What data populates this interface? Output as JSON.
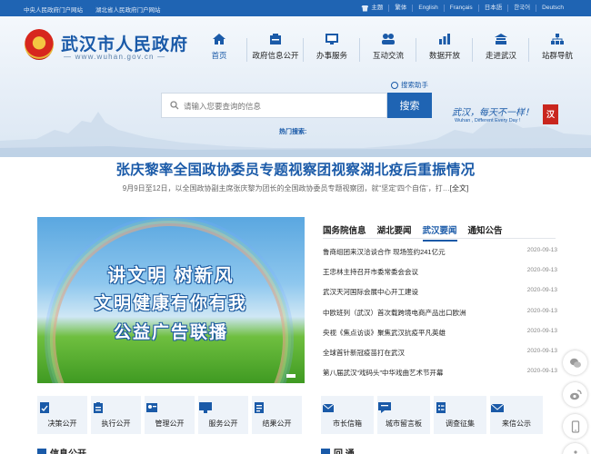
{
  "topbar": {
    "left_links": [
      "中央人民政府门户网站",
      "湖北省人民政府门户网站"
    ],
    "theme_label": "主题",
    "languages": [
      "繁体",
      "English",
      "Français",
      "日本語",
      "한국어",
      "Deutsch"
    ]
  },
  "header": {
    "site_name": "武汉市人民政府",
    "site_url": "— www.wuhan.gov.cn —",
    "nav": [
      {
        "label": "首页",
        "icon": "home-icon"
      },
      {
        "label": "政府信息公开",
        "icon": "info-disclosure-icon"
      },
      {
        "label": "办事服务",
        "icon": "service-icon"
      },
      {
        "label": "互动交流",
        "icon": "interaction-icon"
      },
      {
        "label": "数据开放",
        "icon": "data-icon"
      },
      {
        "label": "走进武汉",
        "icon": "city-icon"
      },
      {
        "label": "站群导航",
        "icon": "sitemap-icon"
      }
    ],
    "search_helper": "搜索助手",
    "search_placeholder": "请输入您要查询的信息",
    "search_button": "搜索",
    "hot_search": "热门搜索:",
    "slogan": "武汉，每天不一样！",
    "slogan_en": "Wuhan , Different Every Day !"
  },
  "headline": {
    "title": "张庆黎率全国政协委员专题视察团视察湖北疫后重振情况",
    "summary": "9月9日至12日，以全国政协副主席张庆黎为团长的全国政协委员专题视察团，就“坚定‘四个自信’，打…",
    "full_text": "[全文]"
  },
  "banner": {
    "line1": "讲文明 树新风",
    "line2": "文明健康有你有我",
    "line3": "公益广告联播"
  },
  "news": {
    "tabs": [
      "国务院信息",
      "湖北要闻",
      "武汉要闻",
      "通知公告"
    ],
    "active_tab": "武汉要闻",
    "items": [
      {
        "title": "鲁商组团来汉洽谈合作 现场签约241亿元",
        "date": "2020-09-13"
      },
      {
        "title": "王忠林主持召开市委常委会会议",
        "date": "2020-09-13"
      },
      {
        "title": "武汉天河国际会展中心开工建设",
        "date": "2020-09-13"
      },
      {
        "title": "中欧班列（武汉）首次载跨境电商产品出口欧洲",
        "date": "2020-09-13"
      },
      {
        "title": "央视《焦点访谈》聚焦武汉抗疫平凡英雄",
        "date": "2020-09-13"
      },
      {
        "title": "全球首针新冠疫苗打在武汉",
        "date": "2020-09-13"
      },
      {
        "title": "第八届武汉“戏码头”中华戏曲艺术节开幕",
        "date": "2020-09-13"
      }
    ]
  },
  "tiles_left": [
    "决策公开",
    "执行公开",
    "管理公开",
    "服务公开",
    "结果公开"
  ],
  "tiles_right": [
    "市长信箱",
    "城市留言板",
    "调查征集",
    "来信公示"
  ],
  "sections": {
    "left": "信息公开",
    "right": "回 通"
  },
  "colors": {
    "primary": "#1f64b3",
    "title_blue": "#1a5aa8"
  }
}
